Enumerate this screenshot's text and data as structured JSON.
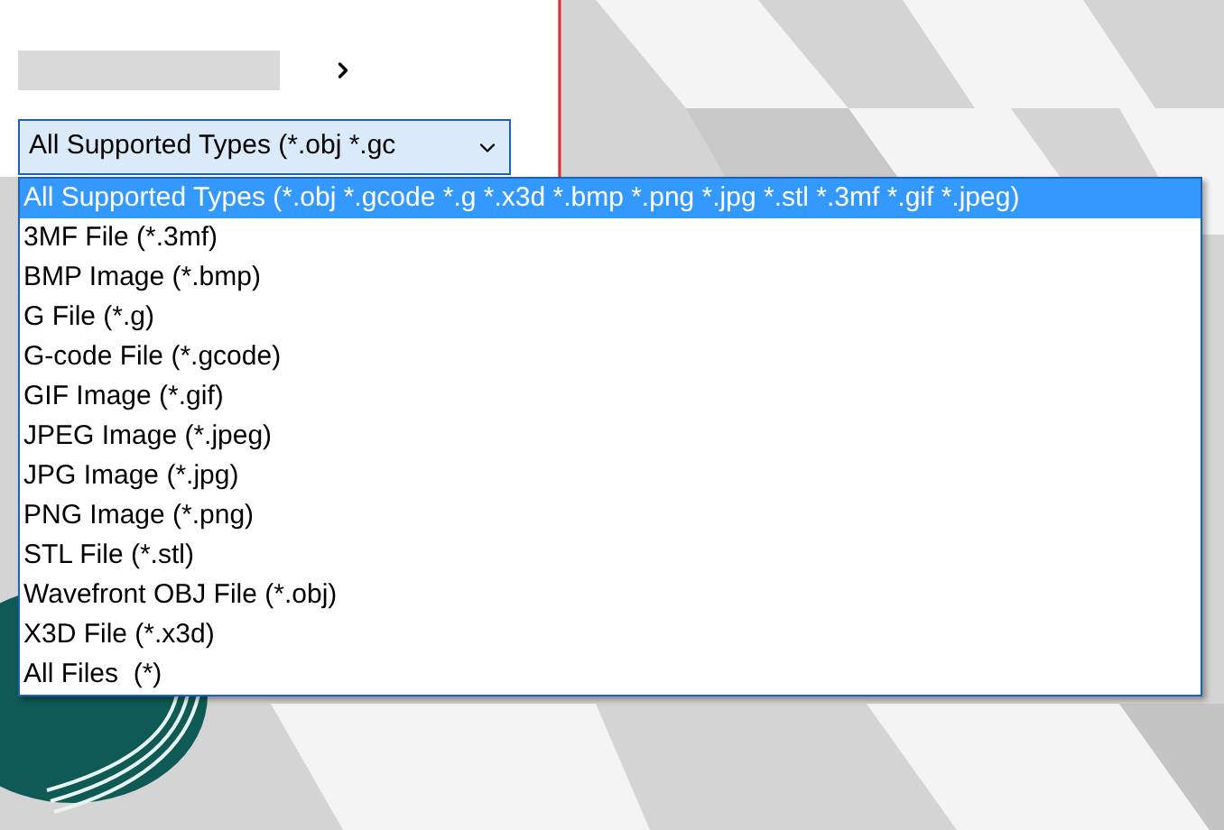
{
  "combo": {
    "value": "All Supported Types (*.obj *.gc",
    "expanded": true
  },
  "options": [
    {
      "label": "All Supported Types (*.obj *.gcode *.g *.x3d *.bmp *.png *.jpg *.stl *.3mf *.gif *.jpeg)",
      "selected": true
    },
    {
      "label": "3MF File (*.3mf)",
      "selected": false
    },
    {
      "label": "BMP Image (*.bmp)",
      "selected": false
    },
    {
      "label": "G File (*.g)",
      "selected": false
    },
    {
      "label": "G-code File (*.gcode)",
      "selected": false
    },
    {
      "label": "GIF Image (*.gif)",
      "selected": false
    },
    {
      "label": "JPEG Image (*.jpeg)",
      "selected": false
    },
    {
      "label": "JPG Image (*.jpg)",
      "selected": false
    },
    {
      "label": "PNG Image (*.png)",
      "selected": false
    },
    {
      "label": "STL File (*.stl)",
      "selected": false
    },
    {
      "label": "Wavefront OBJ File (*.obj)",
      "selected": false
    },
    {
      "label": "X3D File (*.x3d)",
      "selected": false
    },
    {
      "label": "All Files  (*)",
      "selected": false
    }
  ]
}
